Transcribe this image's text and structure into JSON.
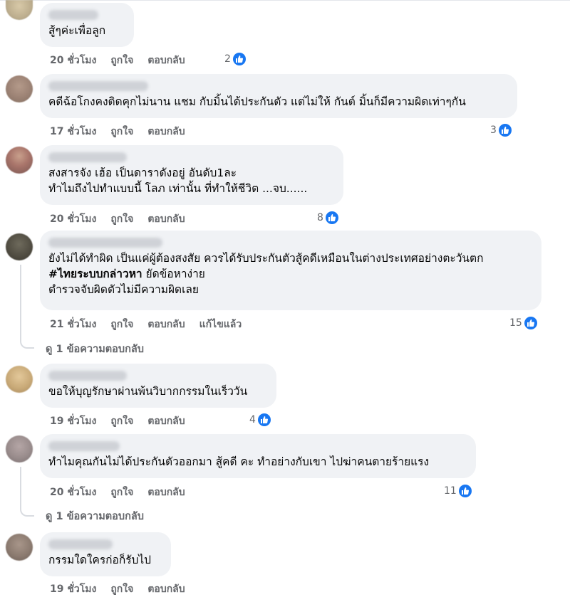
{
  "comments": [
    {
      "text": "สู้ๆค่ะเพื่อลูก",
      "time": "20 ชั่วโมง",
      "like": "ถูกใจ",
      "reply": "ตอบกลับ",
      "reactions": "2"
    },
    {
      "text": "คดีฉ้อโกงคงติดคุกไม่นาน แชม กับมิ้นได้ประกันตัว แต่ไม่ให้ กันต์ มิ้นก็มีความผิดเท่าๆกัน",
      "time": "17 ชั่วโมง",
      "like": "ถูกใจ",
      "reply": "ตอบกลับ",
      "reactions": "3"
    },
    {
      "text_line1": "สงสารจัง เฮ้อ เป็นดาราดังอยู่ อันดับ1ละ",
      "text_line2": "ทำไมถึงไปทำแบบนี้ โลภ เท่านั้น ที่ทำให้ชีวิต ...จบ......",
      "time": "20 ชั่วโมง",
      "like": "ถูกใจ",
      "reply": "ตอบกลับ",
      "reactions": "8"
    },
    {
      "text_line1": "ยังไม่ได้ทำผิด เป็นแค่ผู้ต้องสงสัย ควรได้รับประกันตัวสู้คดีเหมือนในต่างประเทศอย่างตะวันตก",
      "hashtag": "#ไทยระบบกล่าวหา",
      "text_line2_rest": " ยัดข้อหาง่าย",
      "text_line3": "ตำรวจจับผิดตัวไม่มีความผิดเลย",
      "time": "21 ชั่วโมง",
      "like": "ถูกใจ",
      "reply": "ตอบกลับ",
      "edited": "แก้ไขแล้ว",
      "reactions": "15",
      "view_replies": "ดู 1 ข้อความตอบกลับ"
    },
    {
      "text": "ขอให้บุญรักษาผ่านพ้นวิบากกรรมในเร็ววัน",
      "time": "19 ชั่วโมง",
      "like": "ถูกใจ",
      "reply": "ตอบกลับ",
      "reactions": "4"
    },
    {
      "text": "ทำไมคุณกันไม่ได้ประกันตัวออกมา สู้คดี คะ ทำอย่างกับเขา ไปฆ่าคนตายร้ายแรง",
      "time": "20 ชั่วโมง",
      "like": "ถูกใจ",
      "reply": "ตอบกลับ",
      "reactions": "11",
      "view_replies": "ดู 1 ข้อความตอบกลับ"
    },
    {
      "text": "กรรมใดใครก่อก็รับไป",
      "time": "19 ชั่วโมง",
      "like": "ถูกใจ",
      "reply": "ตอบกลับ"
    }
  ],
  "colors": {
    "bubble": "#f0f2f5",
    "meta_text": "#65676b",
    "like_blue": "#1877f2"
  },
  "icons": {
    "reaction": "like-thumb-icon"
  }
}
